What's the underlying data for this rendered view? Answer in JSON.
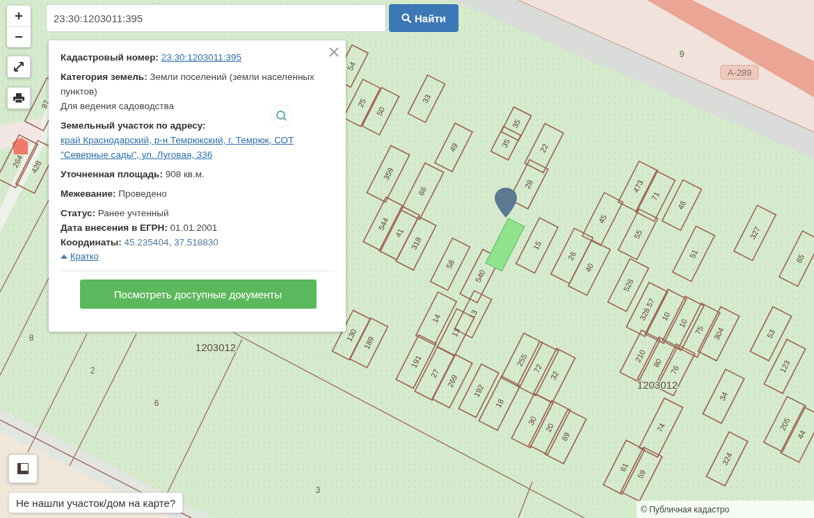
{
  "search": {
    "value": "23:30:1203011:395",
    "button": "Найти"
  },
  "zoom": {
    "in": "+",
    "out": "−"
  },
  "info_popup": {
    "groups": [
      [
        {
          "kind": "link",
          "label": "Кадастровый номер:",
          "value": "23:30:1203011:395"
        }
      ],
      [
        {
          "kind": "text",
          "label": "Категория земель:",
          "value": "Земли поселений (земли населенных пунктов)"
        },
        {
          "kind": "note",
          "value": "Для ведения садоводства"
        }
      ],
      [
        {
          "kind": "link",
          "label": "Земельный участок по адресу:",
          "value": "край Краснодарский, р-н Темрюкский, г. Темрюк, СОТ \"Северные сады\", ул. Луговая, 336"
        }
      ],
      [
        {
          "kind": "text",
          "label": "Уточненная площадь:",
          "value": "908 кв.м."
        }
      ],
      [
        {
          "kind": "text",
          "label": "Межевание:",
          "value": "Проведено"
        }
      ],
      [
        {
          "kind": "text",
          "label": "Статус:",
          "value": "Ранее учтенный"
        },
        {
          "kind": "text",
          "label": "Дата внесения в ЕГРН:",
          "value": "01.01.2001"
        },
        {
          "kind": "accent",
          "label": "Координаты:",
          "value": "45.235404, 37.518830"
        }
      ]
    ],
    "collapse_link": "Кратко",
    "documents_button": "Посмотреть доступные документы"
  },
  "map": {
    "parcels": [
      {
        "number": "54"
      },
      {
        "number": "25"
      },
      {
        "number": "50"
      },
      {
        "number": "33"
      },
      {
        "number": "35"
      },
      {
        "number": "35"
      },
      {
        "number": "22"
      },
      {
        "number": "28"
      },
      {
        "number": "49"
      },
      {
        "number": "359"
      },
      {
        "number": "66"
      },
      {
        "number": "544"
      },
      {
        "number": "41"
      },
      {
        "number": "318"
      },
      {
        "number": "58"
      },
      {
        "number": "540"
      },
      {
        "number": "15"
      },
      {
        "number": "26"
      },
      {
        "number": "40"
      },
      {
        "number": "45"
      },
      {
        "number": "473"
      },
      {
        "number": "71"
      },
      {
        "number": "55"
      },
      {
        "number": "46"
      },
      {
        "number": "51"
      },
      {
        "number": "526"
      },
      {
        "number": "327"
      },
      {
        "number": "65"
      },
      {
        "number": "328.57"
      },
      {
        "number": "10"
      },
      {
        "number": "10"
      },
      {
        "number": "75"
      },
      {
        "number": "304"
      },
      {
        "number": "53"
      },
      {
        "number": "123"
      },
      {
        "number": "210"
      },
      {
        "number": "80"
      },
      {
        "number": "76"
      },
      {
        "number": "34"
      },
      {
        "number": "74"
      },
      {
        "number": "61"
      },
      {
        "number": "59"
      },
      {
        "number": "324"
      },
      {
        "number": "205"
      },
      {
        "number": "44"
      },
      {
        "number": "14"
      },
      {
        "number": "13"
      },
      {
        "number": "13"
      },
      {
        "number": "191"
      },
      {
        "number": "27"
      },
      {
        "number": "269"
      },
      {
        "number": "192"
      },
      {
        "number": "18"
      },
      {
        "number": "255"
      },
      {
        "number": "72"
      },
      {
        "number": "32"
      },
      {
        "number": "30"
      },
      {
        "number": "20"
      },
      {
        "number": "69"
      },
      {
        "number": "130"
      },
      {
        "number": "189"
      },
      {
        "number": "264"
      },
      {
        "number": "428"
      },
      {
        "number": "97"
      }
    ],
    "labels": [
      {
        "kind": "plot",
        "text": "8"
      },
      {
        "kind": "plot",
        "text": "2"
      },
      {
        "kind": "plot",
        "text": "6"
      },
      {
        "kind": "plot",
        "text": "3"
      },
      {
        "kind": "block",
        "text": "1203012"
      },
      {
        "kind": "block",
        "text": "1203012"
      },
      {
        "kind": "plot",
        "text": "9"
      }
    ],
    "highway_badge": "А-289"
  },
  "not_found_button": "Не нашли участок/дом на карте?",
  "attribution": "© Публичная кадастро"
}
